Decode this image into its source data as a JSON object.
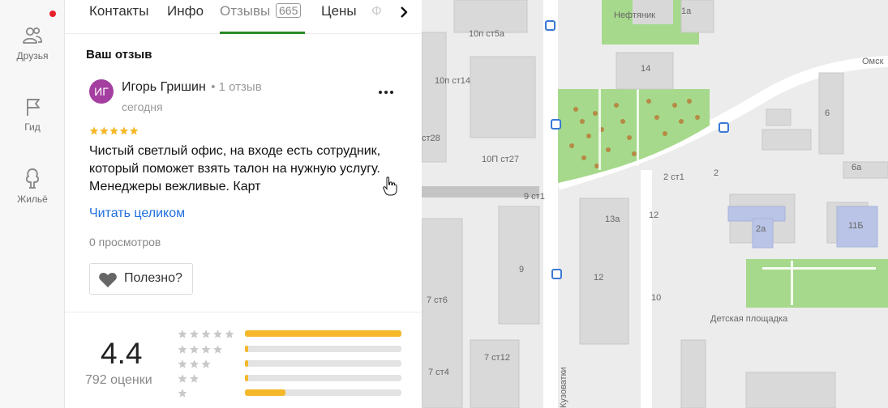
{
  "rail": {
    "friends_label": "Друзья",
    "guide_label": "Гид",
    "housing_label": "Жильё"
  },
  "tabs": {
    "contacts": "Контакты",
    "info": "Инфо",
    "reviews": "Отзывы",
    "reviews_count": "665",
    "prices": "Цены",
    "next_partial": "Ф"
  },
  "review": {
    "section_title": "Ваш отзыв",
    "avatar_initials": "ИГ",
    "author": "Игорь Гришин",
    "author_reviews": "• 1 отзыв",
    "date": "сегодня",
    "stars": 5,
    "text": "Чистый светлый офис, на входе есть сотрудник, который поможет взять талон на нужную услугу. Менеджеры вежливые. Карт",
    "read_more": "Читать целиком",
    "views": "0 просмотров",
    "useful_label": "Полезно?"
  },
  "summary": {
    "rating": "4.4",
    "count_label": "792 оценки",
    "distribution": [
      {
        "stars": 5,
        "fraction": 1.0
      },
      {
        "stars": 4,
        "fraction": 0.02
      },
      {
        "stars": 3,
        "fraction": 0.02
      },
      {
        "stars": 2,
        "fraction": 0.02
      },
      {
        "stars": 1,
        "fraction": 0.26
      }
    ]
  },
  "map": {
    "labels": {
      "neftyanik": "Нефтяник",
      "b1a": "1а",
      "st5a": "10п ст5а",
      "st14": "10п ст14",
      "b14": "14",
      "omsk": "Омск",
      "b6": "6",
      "st28": "ст28",
      "st27": "10П ст27",
      "st1": "2 ст1",
      "b2": "2",
      "b6a": "6а",
      "st9_1": "9 ст1",
      "b13a": "13а",
      "b12a": "12",
      "b2a": "2а",
      "b11b": "11Б",
      "b9": "9",
      "b12b": "12",
      "st6": "7 ст6",
      "b10": "10",
      "playground": "Детская площадка",
      "st12": "7 ст12",
      "st4": "7 ст4",
      "street": "Кузоватки"
    }
  },
  "colors": {
    "accent_green": "#2a8a26",
    "star_yellow": "#f5b82a",
    "link_blue": "#1f6fdc",
    "avatar_purple": "#a43ea0",
    "notification_red": "#e8202c",
    "park_green": "#a6d98b"
  }
}
